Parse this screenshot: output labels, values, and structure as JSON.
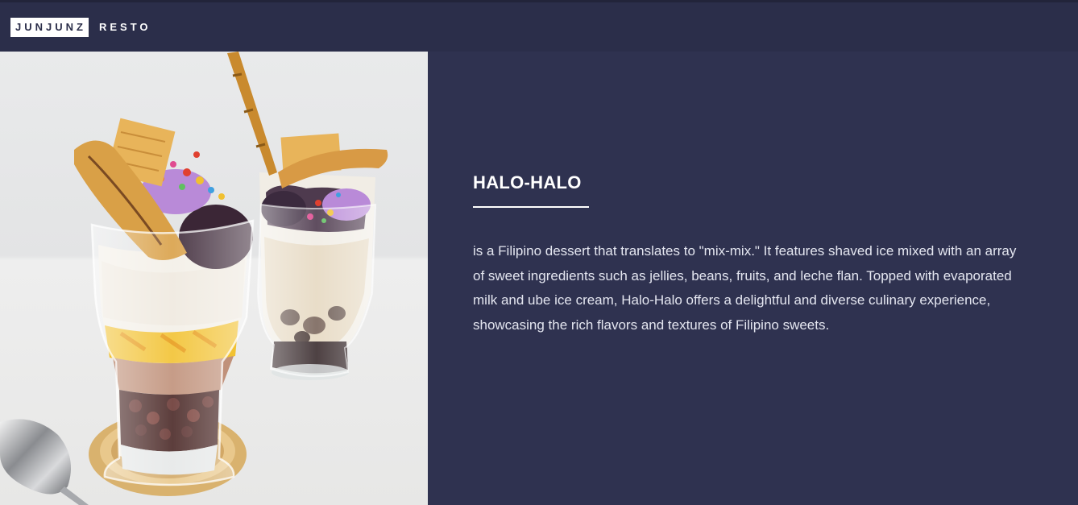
{
  "brand": {
    "box_label": "JUNJUNZ",
    "label": "RESTO"
  },
  "hero": {
    "image_alt": "Two glasses of halo-halo with wafers, purple ube ice cream, colorful cereal, banana, red beans and a spoon",
    "title": "HALO-HALO",
    "description": "is a Filipino dessert that translates to \"mix-mix.\" It features shaved ice mixed with an array of sweet ingredients such as jellies, beans, fruits, and leche flan. Topped with evaporated milk and ube ice cream, Halo-Halo offers a delightful and diverse culinary experience, showcasing the rich flavors and textures of Filipino sweets."
  },
  "colors": {
    "navbar": "#2b2e4a",
    "content_bg": "#2f3250",
    "text": "#ffffff"
  }
}
